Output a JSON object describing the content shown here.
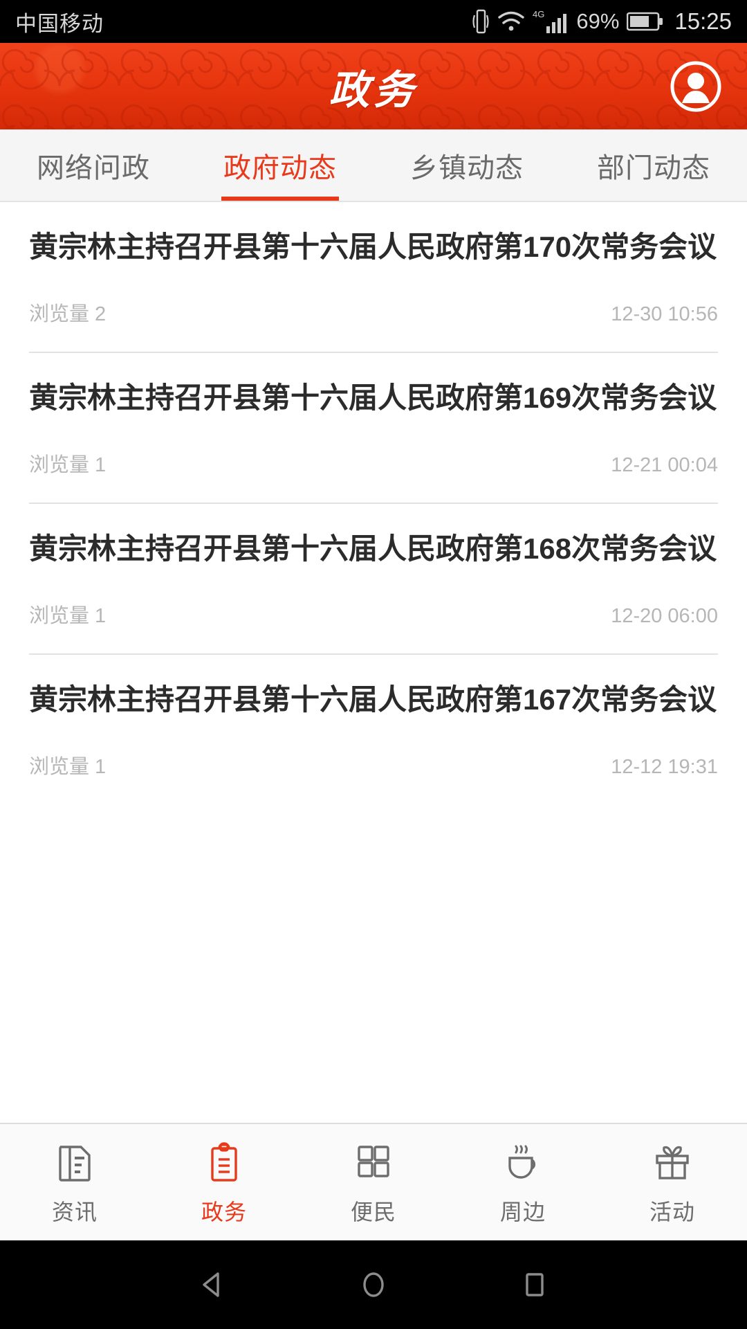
{
  "statusbar": {
    "carrier": "中国移动",
    "network": "4G",
    "battery_percent": "69%",
    "time": "15:25",
    "icons": [
      "vibrate-icon",
      "wifi-icon",
      "signal-icon",
      "battery-icon"
    ]
  },
  "header": {
    "title": "政务",
    "avatar_icon": "user-avatar-icon",
    "background_color": "#e8360f"
  },
  "tabs": {
    "active_index": 1,
    "items": [
      {
        "label": "网络问政"
      },
      {
        "label": "政府动态"
      },
      {
        "label": "乡镇动态"
      },
      {
        "label": "部门动态"
      }
    ],
    "active_color": "#e8391b",
    "inactive_color": "#6a6a6a"
  },
  "news": {
    "views_label": "浏览量",
    "items": [
      {
        "title": "黄宗林主持召开县第十六届人民政府第170次常务会议",
        "views": "浏览量 2",
        "time": "12-30 10:56"
      },
      {
        "title": "黄宗林主持召开县第十六届人民政府第169次常务会议",
        "views": "浏览量 1",
        "time": "12-21 00:04"
      },
      {
        "title": "黄宗林主持召开县第十六届人民政府第168次常务会议",
        "views": "浏览量 1",
        "time": "12-20 06:00"
      },
      {
        "title": "黄宗林主持召开县第十六届人民政府第167次常务会议",
        "views": "浏览量 1",
        "time": "12-12 19:31"
      }
    ]
  },
  "bottomnav": {
    "active_index": 1,
    "items": [
      {
        "label": "资讯",
        "icon": "news-document-icon"
      },
      {
        "label": "政务",
        "icon": "clipboard-icon"
      },
      {
        "label": "便民",
        "icon": "grid-icon"
      },
      {
        "label": "周边",
        "icon": "coffee-cup-icon"
      },
      {
        "label": "活动",
        "icon": "gift-icon"
      }
    ],
    "active_color": "#e8391b",
    "inactive_color": "#6d6d6d"
  },
  "androidnav": {
    "back_icon": "back-triangle-icon",
    "home_icon": "home-circle-icon",
    "recents_icon": "recents-square-icon"
  }
}
